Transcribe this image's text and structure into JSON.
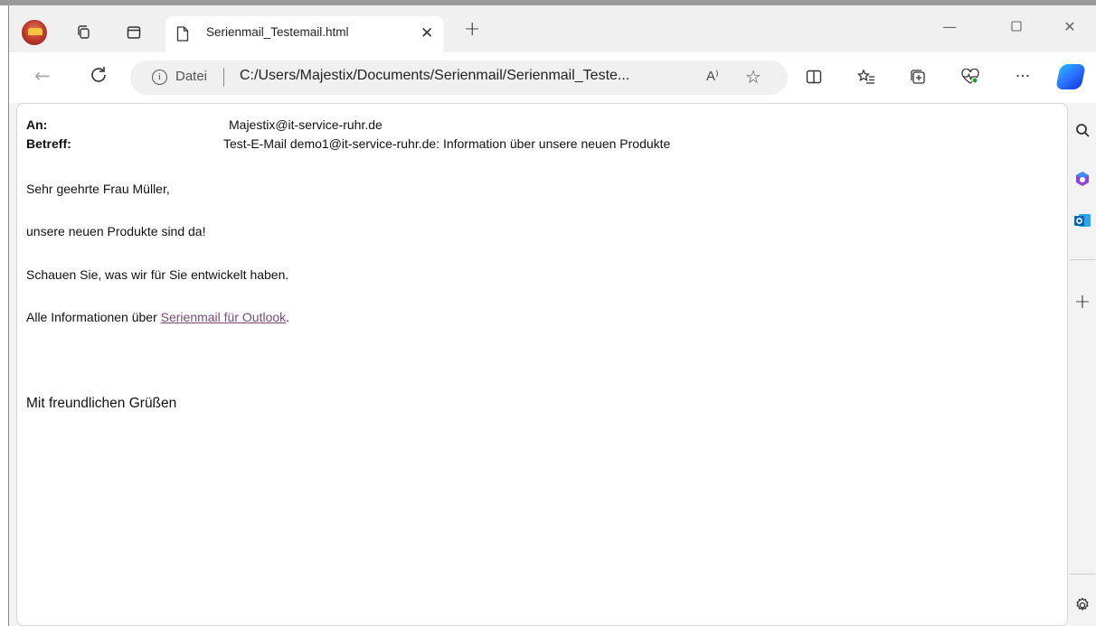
{
  "browser": {
    "tab": {
      "title": "Serienmail_Testemail.html"
    },
    "address": {
      "scheme_label": "Datei",
      "url": "C:/Users/Majestix/Documents/Serienmail/Serienmail_Teste...",
      "read_aloud": "A⁾"
    },
    "icons": {
      "profile": "profile-avatar-icon",
      "workspaces": "workspaces-icon",
      "tab_actions": "tab-actions-icon",
      "document": "document-icon",
      "close": "close-icon",
      "new_tab": "plus-icon",
      "back": "back-arrow-icon",
      "refresh": "refresh-icon",
      "info": "info-icon",
      "favorite": "star-icon",
      "split_screen": "split-screen-icon",
      "favorites": "favorites-list-icon",
      "collections": "collections-icon",
      "browser_essentials": "heart-pulse-icon",
      "more": "more-icon",
      "copilot": "copilot-icon",
      "search": "search-icon",
      "office": "office-icon",
      "outlook": "outlook-icon",
      "add": "plus-icon",
      "settings": "gear-icon"
    }
  },
  "email": {
    "to_label": "An:",
    "to_value": "Majestix@it-service-ruhr.de",
    "subject_label": "Betreff:",
    "subject_value": "Test-E-Mail demo1@it-service-ruhr.de: Information über unsere neuen Produkte",
    "greeting": "Sehr geehrte Frau Müller,",
    "line1": "unsere neuen Produkte sind da!",
    "line2": "Schauen Sie, was wir für Sie entwickelt haben.",
    "line3_prefix": "Alle Informationen über ",
    "line3_link": "Serienmail für Outlook",
    "line3_suffix": ".",
    "closing": "Mit freundlichen Grüßen"
  },
  "colors": {
    "link": "#7a4b7a",
    "copilot": "#2b6cff"
  }
}
